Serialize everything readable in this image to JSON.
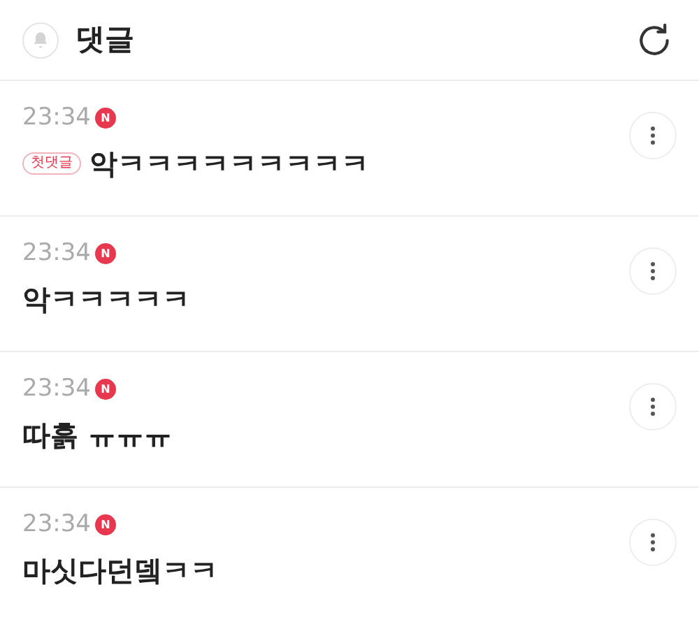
{
  "header": {
    "title": "댓글"
  },
  "comments": [
    {
      "time": "23:34",
      "new": true,
      "new_label": "N",
      "badge": "첫댓글",
      "text": "악ㅋㅋㅋㅋㅋㅋㅋㅋㅋ"
    },
    {
      "time": "23:34",
      "new": true,
      "new_label": "N",
      "text": "악ㅋㅋㅋㅋㅋ"
    },
    {
      "time": "23:34",
      "new": true,
      "new_label": "N",
      "text": "따흙 ㅠㅠㅠ"
    },
    {
      "time": "23:34",
      "new": true,
      "new_label": "N",
      "text": "마싯다던뎈ㅋㅋ"
    }
  ]
}
